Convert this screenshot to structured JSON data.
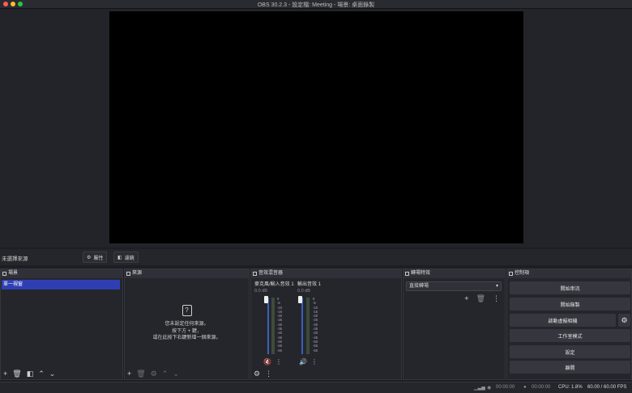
{
  "window": {
    "title": "OBS 30.2.3 - 設定檔: Meeting - 場景: 桌面錄製"
  },
  "context_bar": {
    "selection_label": "未選擇來源",
    "properties_label": "屬性",
    "filters_label": "濾鏡"
  },
  "scenes": {
    "header": "場景",
    "items": [
      "單一視窗"
    ]
  },
  "sources": {
    "header": "來源",
    "empty_line1": "您未設定任何來源。",
    "empty_line2": "按下方 + 鍵，",
    "empty_line3": "或在此按下右鍵新增一個來源。"
  },
  "mixer": {
    "header": "音效混音器",
    "channels": [
      {
        "name": "麥克風/輸入音效 1",
        "db": "0.0 dB",
        "muted": true
      },
      {
        "name": "輸出音效 1",
        "db": "0.0 dB",
        "muted": false
      }
    ],
    "scale": [
      "0",
      "-5",
      "-10",
      "-15",
      "-20",
      "-25",
      "-30",
      "-35",
      "-40",
      "-45",
      "-50",
      "-55",
      "-60"
    ]
  },
  "transitions": {
    "header": "轉場特效",
    "selected": "直接轉場"
  },
  "controls": {
    "header": "控制項",
    "start_streaming": "開始串流",
    "start_recording": "開始錄製",
    "start_virtual_camera": "啟動虛擬相機",
    "studio_mode": "工作室模式",
    "settings": "設定",
    "exit": "離開"
  },
  "status": {
    "stream_time": "00:00:00",
    "record_time": "00:00:00",
    "cpu": "CPU: 1.8%",
    "fps": "60.00 / 60.00 FPS"
  },
  "colors": {
    "accent": "#2f3fb3",
    "background": "#1d1e23",
    "canvas": "#000000"
  }
}
